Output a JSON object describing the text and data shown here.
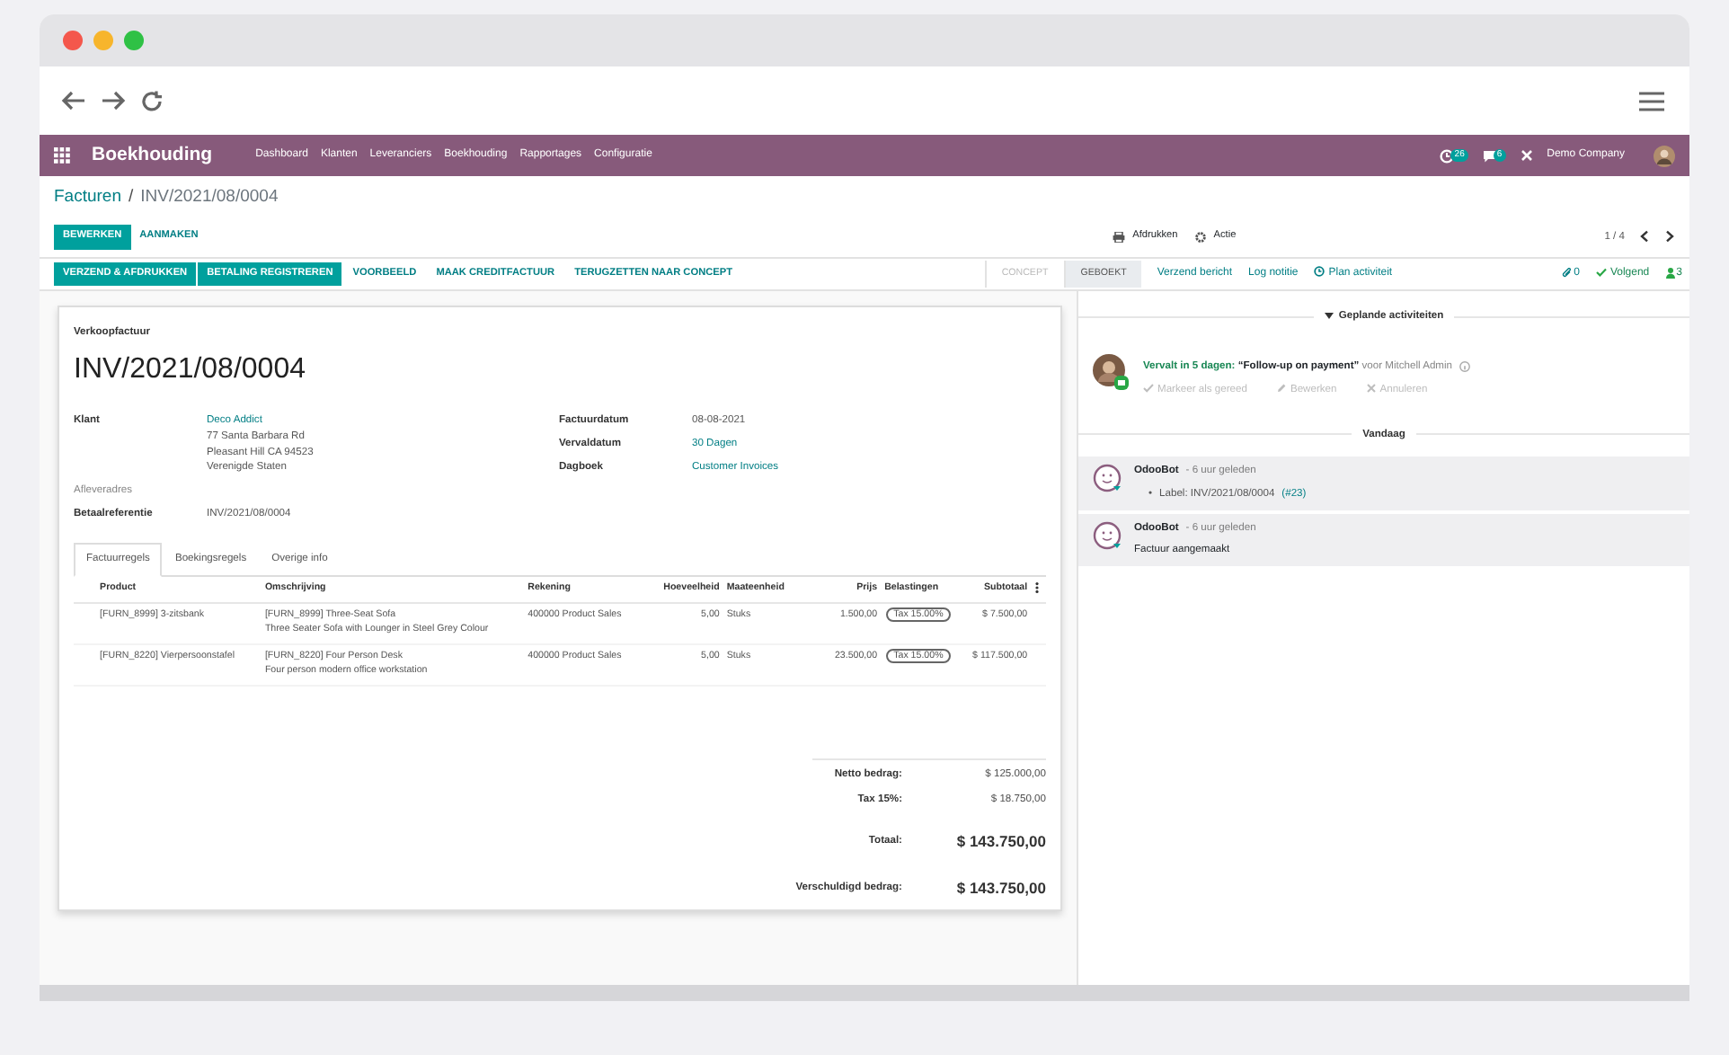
{
  "app": {
    "name": "Boekhouding",
    "menu": [
      "Dashboard",
      "Klanten",
      "Leveranciers",
      "Boekhouding",
      "Rapportages",
      "Configuratie"
    ],
    "activity_count": "26",
    "message_count": "6",
    "company": "Demo Company"
  },
  "breadcrumb": {
    "parent": "Facturen",
    "separator": "/",
    "current": "INV/2021/08/0004"
  },
  "control_buttons": [
    {
      "label": "BEWERKEN",
      "kind": "primary"
    },
    {
      "label": "AANMAKEN",
      "kind": "link"
    }
  ],
  "print": "Afdrukken",
  "action": "Actie",
  "pager": "1 / 4",
  "header_buttons": [
    {
      "label": "VERZEND & AFDRUKKEN",
      "kind": "primary"
    },
    {
      "label": "BETALING REGISTREREN",
      "kind": "primary"
    },
    {
      "label": "VOORBEELD",
      "kind": "link"
    },
    {
      "label": "MAAK CREDITFACTUUR",
      "kind": "link"
    },
    {
      "label": "TERUGZETTEN NAAR CONCEPT",
      "kind": "link"
    }
  ],
  "stages": [
    {
      "label": "CONCEPT",
      "selected": false
    },
    {
      "label": "GEBOEKT",
      "selected": true
    }
  ],
  "chatter_buttons": [
    "Verzend bericht",
    "Log notitie",
    "Plan activiteit"
  ],
  "attachments": "0",
  "follow": "Volgend",
  "followers": "3",
  "sheet": {
    "type_label": "Verkoopfactuur",
    "title": "INV/2021/08/0004",
    "customer": {
      "label": "Klant",
      "name": "Deco Addict",
      "address": [
        "77 Santa Barbara Rd",
        "Pleasant Hill CA 94523",
        "Verenigde Staten"
      ]
    },
    "delivery_label": "Afleveradres",
    "payment_ref": {
      "label": "Betaalreferentie",
      "value": "INV/2021/08/0004"
    },
    "right_fields": [
      {
        "label": "Factuurdatum",
        "value": "08-08-2021",
        "link": false
      },
      {
        "label": "Vervaldatum",
        "value": "30 Dagen",
        "link": true
      },
      {
        "label": "Dagboek",
        "value": "Customer Invoices",
        "link": true
      }
    ],
    "tabs": [
      {
        "label": "Factuurregels",
        "selected": true
      },
      {
        "label": "Boekingsregels",
        "selected": false
      },
      {
        "label": "Overige info",
        "selected": false
      }
    ],
    "columns": [
      "Product",
      "Omschrijving",
      "Rekening",
      "Hoeveelheid",
      "Maateenheid",
      "Prijs",
      "Belastingen",
      "Subtotaal"
    ],
    "rows": [
      {
        "product": "[FURN_8999] 3-zitsbank",
        "description": [
          "[FURN_8999] Three-Seat Sofa",
          "Three Seater Sofa with Lounger in Steel Grey Colour"
        ],
        "account": "400000 Product Sales",
        "quantity": "5,00",
        "unit": "Stuks",
        "price": "1.500,00",
        "tax": "Tax 15.00%",
        "subtotal": "$ 7.500,00"
      },
      {
        "product": "[FURN_8220] Vierpersoonstafel",
        "description": [
          "[FURN_8220] Four Person Desk",
          "Four person modern office workstation"
        ],
        "account": "400000 Product Sales",
        "quantity": "5,00",
        "unit": "Stuks",
        "price": "23.500,00",
        "tax": "Tax 15.00%",
        "subtotal": "$ 117.500,00"
      }
    ],
    "totals": [
      {
        "label": "Netto bedrag:",
        "value": "$ 125.000,00",
        "kind": "minor"
      },
      {
        "label": "Tax 15%:",
        "value": "$ 18.750,00",
        "kind": "minor"
      },
      {
        "label": "Totaal:",
        "value": "$ 143.750,00",
        "kind": "major"
      },
      {
        "label": "Verschuldigd bedrag:",
        "value": "$ 143.750,00",
        "kind": "major"
      }
    ]
  },
  "chatter": {
    "activities_header": "Geplande activiteiten",
    "activity": {
      "due": "Vervalt in 5 dagen:",
      "summary": "“Follow-up on payment”",
      "user": "voor Mitchell Admin",
      "actions": [
        "Markeer als gereed",
        "Bewerken",
        "Annuleren"
      ]
    },
    "separator": "Vandaag",
    "messages": [
      {
        "author": "OdooBot",
        "time": "- 6 uur geleden",
        "kind": "tracking",
        "bullet": "•",
        "body": "Label: INV/2021/08/0004",
        "ref": "(#23)"
      },
      {
        "author": "OdooBot",
        "time": "- 6 uur geleden",
        "kind": "text",
        "body": "Factuur aangemaakt"
      }
    ]
  }
}
